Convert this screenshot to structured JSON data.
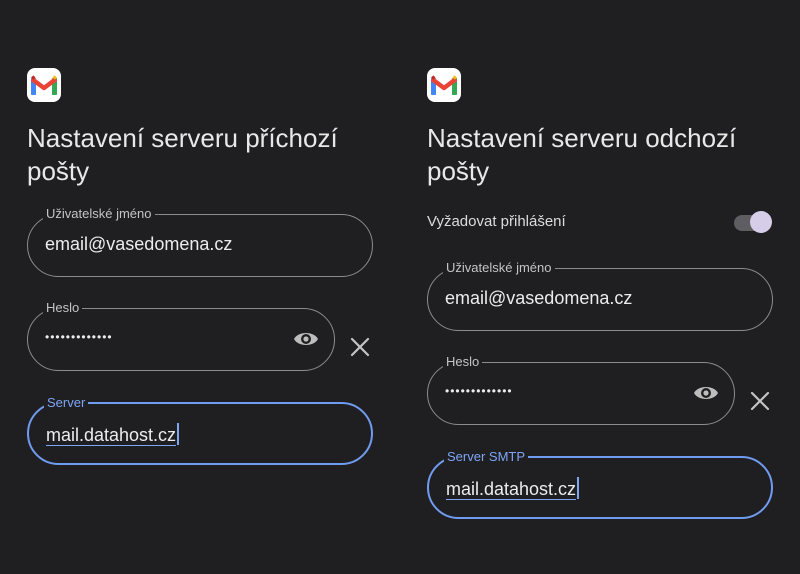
{
  "incoming": {
    "title": "Nastavení serveru příchozí pošty",
    "username": {
      "label": "Uživatelské jméno",
      "value": "email@vasedomena.cz"
    },
    "password": {
      "label": "Heslo",
      "value": "•••••••••••••"
    },
    "server": {
      "label": "Server",
      "value": "mail.datahost.cz"
    }
  },
  "outgoing": {
    "title": "Nastavení serveru odchozí pošty",
    "require_signin": {
      "label": "Vyžadovat přihlášení",
      "enabled": true
    },
    "username": {
      "label": "Uživatelské jméno",
      "value": "email@vasedomena.cz"
    },
    "password": {
      "label": "Heslo",
      "value": "•••••••••••••"
    },
    "server": {
      "label": "Server SMTP",
      "value": "mail.datahost.cz"
    }
  },
  "icons": {
    "app": "gmail-logo",
    "show_password": "eye-icon",
    "clear": "close-icon"
  },
  "colors": {
    "background": "#1f1f21",
    "focus_accent": "#7da6f5",
    "outline": "#8c8c8e",
    "switch_thumb": "#d6cde9"
  }
}
